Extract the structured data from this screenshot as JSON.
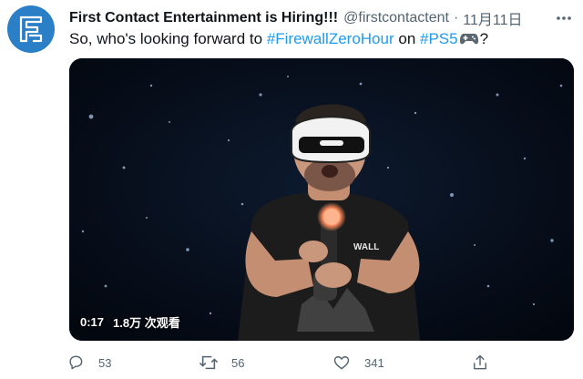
{
  "tweet": {
    "author": {
      "display_name": "First Contact Entertainment is Hiring!!!",
      "handle": "@firstcontactent",
      "separator": "·",
      "time": "11月11日"
    },
    "text": {
      "before": "So, who's looking forward to ",
      "hashtag1": "#FirewallZeroHour",
      "middle": " on ",
      "hashtag2": "#PS5",
      "after": "?"
    },
    "media": {
      "duration": "0:17",
      "views": "1.8万 次观看",
      "shirt_text": "WALL",
      "colors": {
        "background": "#050a14",
        "headset": "#f2f2f2",
        "controller_light": "#ff8a5b",
        "shirt": "#1c1c1c"
      }
    },
    "actions": {
      "reply_count": "53",
      "retweet_count": "56",
      "like_count": "341"
    }
  },
  "colors": {
    "accent": "#1d9bf0",
    "muted": "#536471",
    "avatar_bg": "#2a7fc7"
  }
}
